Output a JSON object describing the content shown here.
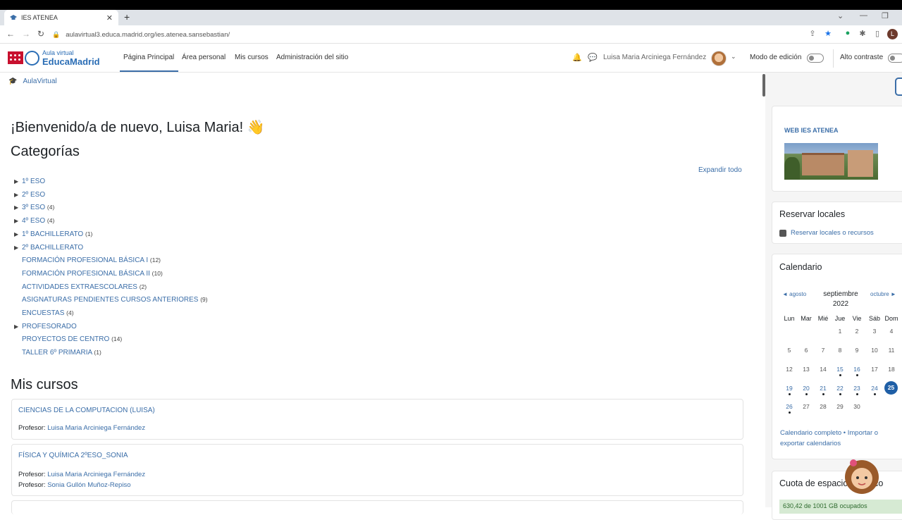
{
  "browser": {
    "tab_title": "IES ATENEA",
    "url": "aulavirtual3.educa.madrid.org/ies.atenea.sansebastian/",
    "profile_initial": "L"
  },
  "header": {
    "logo_small": "Aula virtual",
    "logo_big": "EducaMadrid",
    "nav": [
      "Página Principal",
      "Área personal",
      "Mis cursos",
      "Administración del sitio"
    ],
    "user_name": "Luisa Maria Arciniega Fernández",
    "edit_mode_label": "Modo de edición",
    "contrast_label": "Alto contraste"
  },
  "breadcrumb": {
    "label": "AulaVirtual"
  },
  "main": {
    "welcome": "¡Bienvenido/a de nuevo, Luisa Maria! 👋",
    "categories_heading": "Categorías",
    "expand_all": "Expandir todo",
    "categories": [
      {
        "name": "1º ESO",
        "count": "",
        "expandable": true
      },
      {
        "name": "2º ESO",
        "count": "",
        "expandable": true
      },
      {
        "name": "3º ESO",
        "count": "(4)",
        "expandable": true
      },
      {
        "name": "4º ESO",
        "count": "(4)",
        "expandable": true
      },
      {
        "name": "1º BACHILLERATO",
        "count": "(1)",
        "expandable": true
      },
      {
        "name": "2º BACHILLERATO",
        "count": "",
        "expandable": true
      },
      {
        "name": "FORMACIÓN PROFESIONAL BÁSICA I",
        "count": "(12)",
        "expandable": false
      },
      {
        "name": "FORMACIÓN PROFESIONAL BÁSICA II",
        "count": "(10)",
        "expandable": false
      },
      {
        "name": "ACTIVIDADES EXTRAESCOLARES",
        "count": "(2)",
        "expandable": false
      },
      {
        "name": "ASIGNATURAS PENDIENTES CURSOS ANTERIORES",
        "count": "(9)",
        "expandable": false
      },
      {
        "name": "ENCUESTAS",
        "count": "(4)",
        "expandable": false
      },
      {
        "name": "PROFESORADO",
        "count": "",
        "expandable": true
      },
      {
        "name": "PROYECTOS DE CENTRO",
        "count": "(14)",
        "expandable": false
      },
      {
        "name": "TALLER 6º PRIMARIA",
        "count": "(1)",
        "expandable": false
      }
    ],
    "courses_heading": "Mis cursos",
    "courses": [
      {
        "title": "CIENCIAS DE LA COMPUTACION (LUISA)",
        "teachers": [
          "Luisa Maria Arciniega Fernández"
        ]
      },
      {
        "title": "FÍSICA Y QUÍMICA 2ºESO_SONIA",
        "teachers": [
          "Luisa Maria Arciniega Fernández",
          "Sonia Gullón Muñoz-Repiso"
        ]
      }
    ],
    "teacher_label": "Profesor:"
  },
  "sidebar": {
    "web_title": "WEB IES ATENEA",
    "reserve_title": "Reservar locales",
    "reserve_link": "Reservar locales o recursos",
    "calendar_title": "Calendario",
    "cal_prev": "◄ agosto",
    "cal_next": "octubre ►",
    "cal_month": "septiembre 2022",
    "cal_dow": [
      "Lun",
      "Mar",
      "Mié",
      "Jue",
      "Vie",
      "Sáb",
      "Dom"
    ],
    "cal_weeks": [
      [
        "",
        "",
        "",
        "1",
        "2",
        "3",
        "4"
      ],
      [
        "5",
        "6",
        "7",
        "8",
        "9",
        "10",
        "11"
      ],
      [
        "12",
        "13",
        "14",
        "15",
        "16",
        "17",
        "18"
      ],
      [
        "19",
        "20",
        "21",
        "22",
        "23",
        "24",
        "25"
      ],
      [
        "26",
        "27",
        "28",
        "29",
        "30",
        "",
        ""
      ]
    ],
    "cal_event_days": [
      "15",
      "16",
      "19",
      "20",
      "21",
      "22",
      "23",
      "24",
      "26"
    ],
    "cal_today": "25",
    "cal_full_link": "Calendario completo",
    "cal_export_link": "Importar o exportar calendarios",
    "quota_title": "Cuota de espacio en disco",
    "quota_text": "630,42 de 1001 GB ocupados"
  },
  "colors": {
    "accent": "#3b6ea8",
    "today": "#1f5fa6",
    "brand_red": "#c8102e"
  }
}
